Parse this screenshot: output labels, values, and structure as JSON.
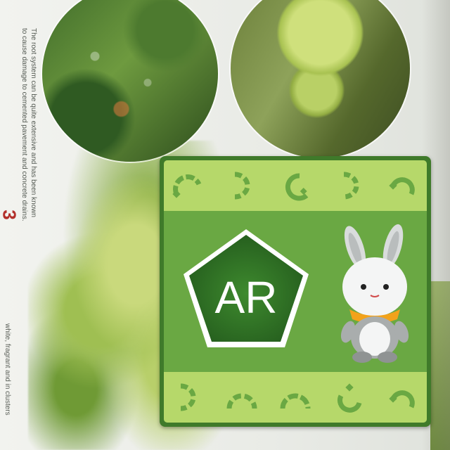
{
  "book_page": {
    "step_number": "3",
    "step_text": "The root system can be quite extensive and has been known to cause damage to cemented pavement and concrete drains.",
    "caption_partial": "white, fragrant and in clusters"
  },
  "ar_card": {
    "badge_text": "AR",
    "mascot": "rabbit-mascot",
    "colors": {
      "frame": "#3f7a2a",
      "band": "#b6d86a",
      "panel": "#6aa843",
      "pentagon": "#2f6f26",
      "scarf": "#f2a21b"
    }
  }
}
